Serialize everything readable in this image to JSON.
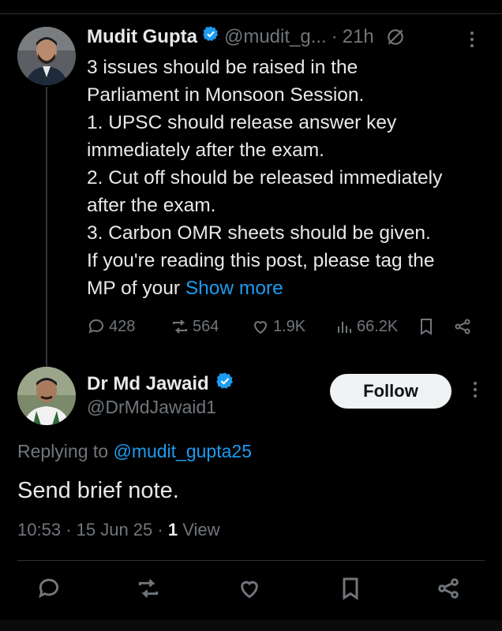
{
  "tweet": {
    "author_name": "Mudit Gupta",
    "handle": "@mudit_g...",
    "dot": "·",
    "time": "21h",
    "body": "3 issues should be raised in the\nParliament in Monsoon Session.\n1. UPSC should release answer key\nimmediately after the exam.\n2. Cut off should be released immediately\nafter the exam.\n3. Carbon OMR sheets should be given.\nIf you're reading this post, please tag the\nMP of your ",
    "show_more": "Show more",
    "stats": {
      "replies": "428",
      "reposts": "564",
      "likes": "1.9K",
      "views": "66.2K"
    }
  },
  "reply": {
    "author_name": "Dr Md Jawaid",
    "handle": "@DrMdJawaid1",
    "follow_label": "Follow",
    "replying_prefix": "Replying to ",
    "replying_handle": "@mudit_gupta25",
    "text": "Send brief note.",
    "time": "10:53",
    "date": "15 Jun 25",
    "views_count": "1",
    "views_label": "View"
  },
  "colors": {
    "background": "#000000",
    "text": "#e7e9ea",
    "muted": "#71767b",
    "link": "#1d9bf0",
    "verified": "#1d9bf0"
  }
}
